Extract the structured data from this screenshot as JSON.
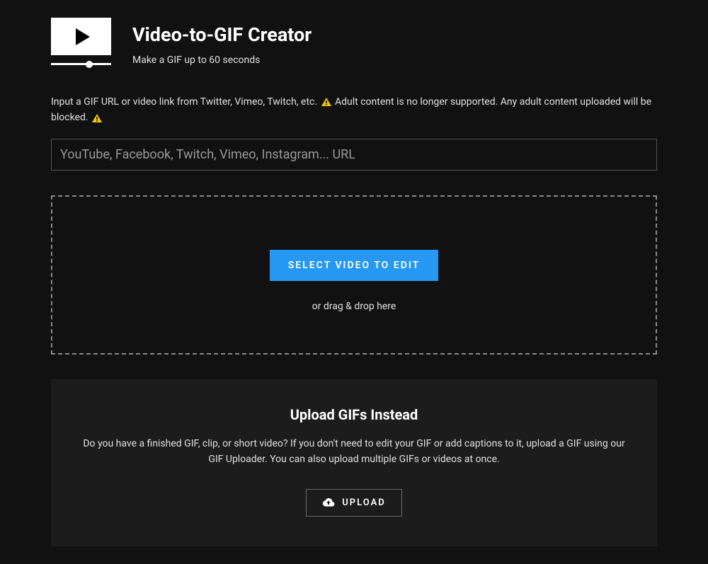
{
  "header": {
    "title": "Video-to-GIF Creator",
    "subtitle": "Make a GIF up to 60 seconds"
  },
  "instructions": {
    "part1": "Input a GIF URL or video link from Twitter, Vimeo, Twitch, etc. ",
    "part2": " Adult content is no longer supported. Any adult content uploaded will be blocked. "
  },
  "urlInput": {
    "placeholder": "YouTube, Facebook, Twitch, Vimeo, Instagram... URL",
    "value": ""
  },
  "dropzone": {
    "buttonLabel": "SELECT VIDEO TO EDIT",
    "dragText": "or drag & drop here"
  },
  "uploadSection": {
    "title": "Upload GIFs Instead",
    "description": "Do you have a finished GIF, clip, or short video? If you don't need to edit your GIF or add captions to it, upload a GIF using our GIF Uploader. You can also upload multiple GIFs or videos at once.",
    "buttonLabel": "UPLOAD"
  }
}
